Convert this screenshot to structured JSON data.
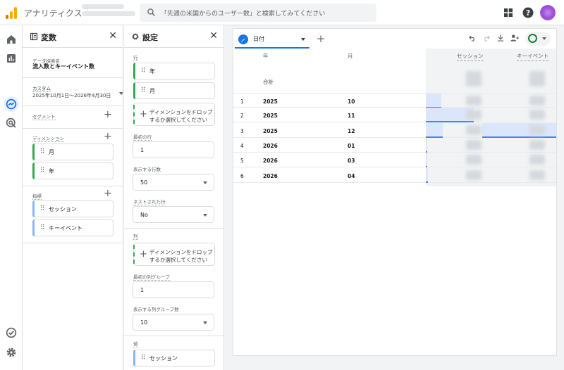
{
  "app": {
    "title": "アナリティクス"
  },
  "search": {
    "placeholder": "「先週の米国からのユーザー数」と検索してみてください"
  },
  "colors": {
    "accent": "#1a73e8",
    "dimension_bar": "#34a853",
    "metric_bar": "#8ab4f8",
    "logo_orange": "#f9ab00",
    "logo_dark": "#e37400"
  },
  "left_nav": {
    "items": [
      "home-icon",
      "reports-icon",
      "explore-icon",
      "advertising-icon",
      "configure-icon",
      "settings-icon"
    ]
  },
  "variables_panel": {
    "title": "変数",
    "name_label": "データ探索名:",
    "name_value": "流入数とキーイベント数",
    "date_label": "カスタム",
    "date_range": "2025年10月1日～2026年4月30日",
    "segment_label": "セグメント",
    "dimension_label": "ディメンション",
    "dimensions": [
      "月",
      "年"
    ],
    "metric_label": "指標",
    "metrics": [
      "セッション",
      "キーイベント"
    ]
  },
  "settings_panel": {
    "title": "設定",
    "rows_label": "行",
    "rows": [
      "年",
      "月"
    ],
    "drop_text": "ディメンションをドロップするか選択してください",
    "start_row_label": "最初の行",
    "start_row_value": "1",
    "show_rows_label": "表示する行数",
    "show_rows_value": "50",
    "nested_rows_label": "ネストされた行",
    "nested_rows_value": "No",
    "columns_label": "列",
    "column_drop_text": "ディメンションをドロップするか選択してください",
    "first_col_group_label": "最初の列グループ",
    "first_col_group_value": "1",
    "show_col_groups_label": "表示する列グループ数",
    "show_col_groups_value": "10",
    "values_label": "値",
    "values": [
      "セッション"
    ]
  },
  "canvas": {
    "tab_label": "日付",
    "table": {
      "headers": [
        "年",
        "月",
        "セッション",
        "キーイベント"
      ],
      "total_label": "合計",
      "rows": [
        {
          "index": "1",
          "year": "2025",
          "month": "10",
          "sessions_share": 0.27,
          "keyevents_share": 0.0
        },
        {
          "index": "2",
          "year": "2025",
          "month": "11",
          "sessions_share": 0.85,
          "keyevents_share": 0.0
        },
        {
          "index": "3",
          "year": "2025",
          "month": "12",
          "sessions_share": 0.3,
          "keyevents_share": 1.0
        },
        {
          "index": "4",
          "year": "2026",
          "month": "01",
          "sessions_share": 0.02,
          "keyevents_share": 0.0
        },
        {
          "index": "5",
          "year": "2026",
          "month": "03",
          "sessions_share": 0.03,
          "keyevents_share": 0.0
        },
        {
          "index": "6",
          "year": "2026",
          "month": "04",
          "sessions_share": 0.04,
          "keyevents_share": 0.0
        }
      ]
    }
  }
}
